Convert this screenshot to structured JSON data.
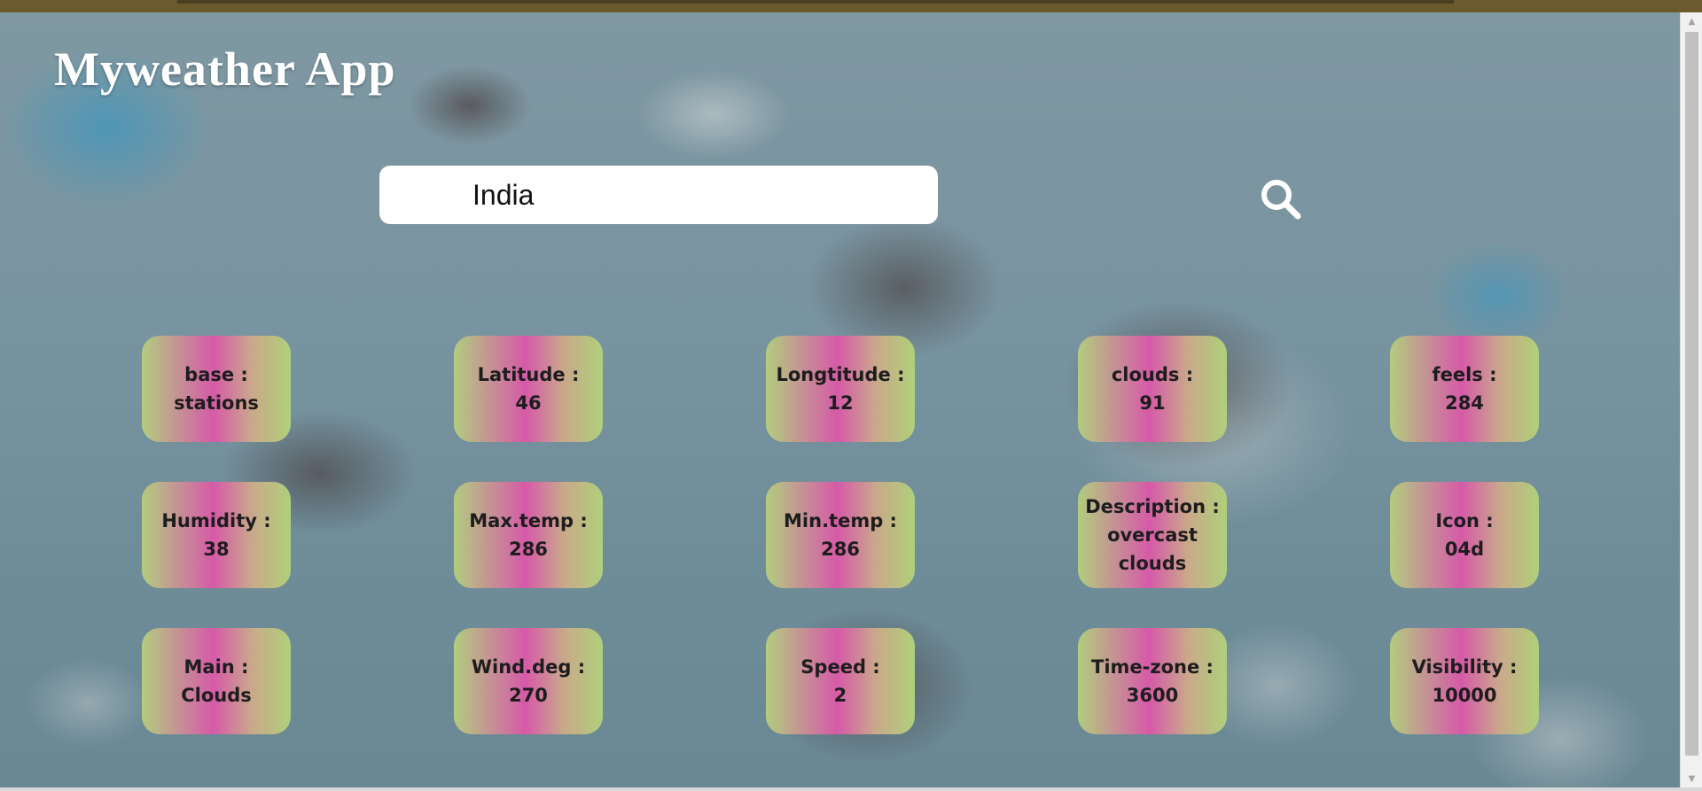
{
  "app": {
    "title": "Myweather App"
  },
  "search": {
    "value": "India",
    "icon": "search-icon"
  },
  "cards": [
    {
      "label": "base :",
      "value": "stations"
    },
    {
      "label": "Latitude :",
      "value": "46"
    },
    {
      "label": "Longtitude :",
      "value": "12"
    },
    {
      "label": "clouds :",
      "value": "91"
    },
    {
      "label": "feels :",
      "value": "284"
    },
    {
      "label": "Humidity :",
      "value": "38"
    },
    {
      "label": "Max.temp :",
      "value": "286"
    },
    {
      "label": "Min.temp :",
      "value": "286"
    },
    {
      "label": "Description :",
      "value": "overcast clouds"
    },
    {
      "label": "Icon :",
      "value": "04d"
    },
    {
      "label": "Main :",
      "value": "Clouds"
    },
    {
      "label": "Wind.deg :",
      "value": "270"
    },
    {
      "label": "Speed :",
      "value": "2"
    },
    {
      "label": "Time-zone :",
      "value": "3600"
    },
    {
      "label": "Visibility :",
      "value": "10000"
    }
  ],
  "colors": {
    "card_gradient": [
      "#b2cd7e",
      "#d65aa8",
      "#c9a98a",
      "#afd07a"
    ],
    "title": "#ffffff"
  }
}
